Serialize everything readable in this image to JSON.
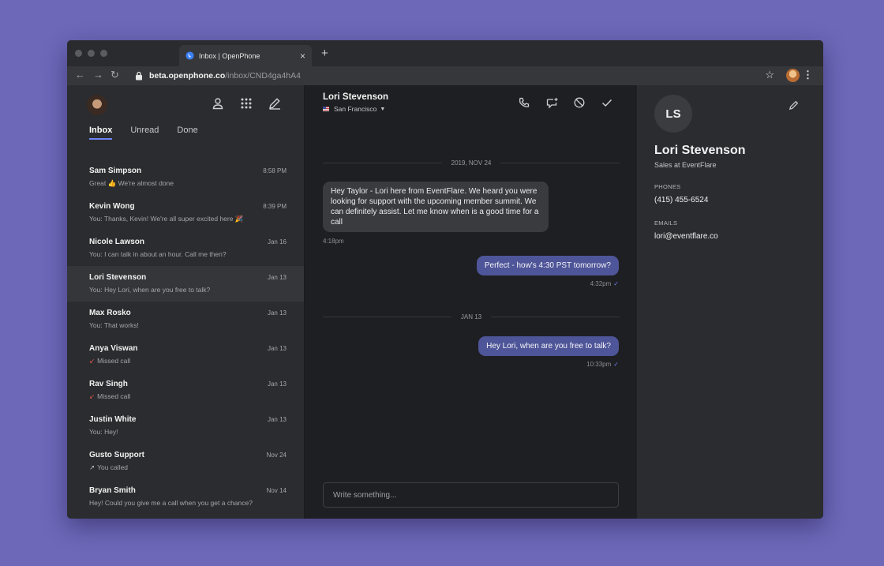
{
  "browser": {
    "tab_title": "Inbox | OpenPhone",
    "tab_close": "×",
    "new_tab": "+",
    "url_host": "beta.openphone.co",
    "url_path": "/inbox/CND4ga4hA4"
  },
  "sidebar": {
    "tabs": [
      {
        "label": "Inbox",
        "active": true
      },
      {
        "label": "Unread"
      },
      {
        "label": "Done"
      }
    ],
    "conversations": [
      {
        "name": "Sam Simpson",
        "time": "8:58 PM",
        "preview": "Great 👍 We're almost done"
      },
      {
        "name": "Kevin Wong",
        "time": "8:39 PM",
        "preview": "You: Thanks, Kevin! We're all super excited here 🎉"
      },
      {
        "name": "Nicole Lawson",
        "time": "Jan 16",
        "preview": "You: I can talk in about an hour. Call me then?"
      },
      {
        "name": "Lori Stevenson",
        "time": "Jan 13",
        "preview": "You: Hey Lori, when are you free to talk?",
        "selected": true
      },
      {
        "name": "Max Rosko",
        "time": "Jan 13",
        "preview": "You: That works!"
      },
      {
        "name": "Anya Viswan",
        "time": "Jan 13",
        "preview": "Missed call",
        "preview_icon": "↙"
      },
      {
        "name": "Rav Singh",
        "time": "Jan 13",
        "preview": "Missed call",
        "preview_icon": "↙"
      },
      {
        "name": "Justin White",
        "time": "Jan 13",
        "preview": "You: Hey!"
      },
      {
        "name": "Gusto Support",
        "time": "Nov 24",
        "preview": "You called",
        "preview_icon": "↗"
      },
      {
        "name": "Bryan Smith",
        "time": "Nov 14",
        "preview": "Hey! Could you give me a call when you get a chance?"
      }
    ]
  },
  "chat": {
    "contact_name": "Lori Stevenson",
    "location": "San Francisco",
    "date_sep_1": "2019, NOV 24",
    "msg_1": "Hey Taylor - Lori here from EventFlare. We heard you were looking for support with the upcoming member summit. We can definitely assist. Let me know when is a good time for a call",
    "msg_1_time": "4:18pm",
    "msg_2": "Perfect - how's 4:30 PST tomorrow?",
    "msg_2_time": "4:32pm",
    "date_sep_2": "JAN 13",
    "msg_3": "Hey Lori, when are you free to talk?",
    "msg_3_time": "10:33pm",
    "check": "✓",
    "composer_placeholder": "Write something..."
  },
  "contact_panel": {
    "initials": "LS",
    "name": "Lori Stevenson",
    "title": "Sales at EventFlare",
    "phones_label": "PHONES",
    "phone": "(415) 455-6524",
    "emails_label": "EMAILS",
    "email": "lori@eventflare.co"
  },
  "colors": {
    "background": "#6d68b8",
    "accent": "#6f82f6",
    "outgoing_bubble": "#4e5598",
    "missed_call": "#e0584e"
  }
}
